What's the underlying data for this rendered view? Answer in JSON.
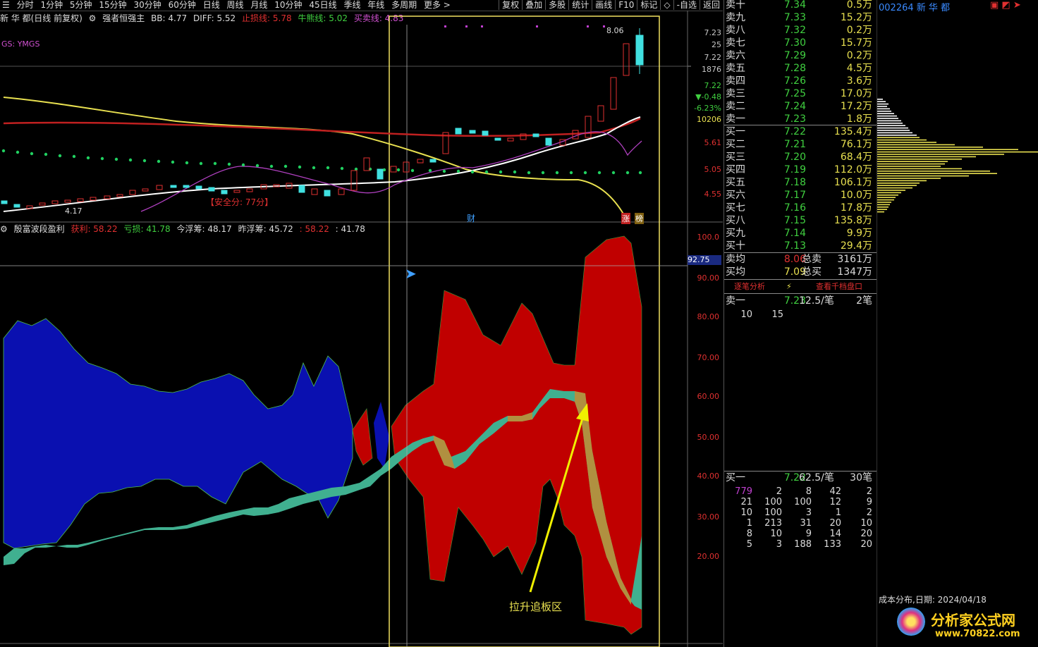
{
  "toolbar": {
    "periods": [
      "分时",
      "1分钟",
      "5分钟",
      "15分钟",
      "30分钟",
      "60分钟",
      "日线",
      "周线",
      "月线",
      "10分钟",
      "45日线",
      "季线",
      "年线",
      "多周期",
      "更多 >"
    ],
    "buttons": [
      "复权",
      "叠加",
      "多股",
      "统计",
      "画线",
      "F10",
      "标记",
      "-自选",
      "返回"
    ]
  },
  "indicator_bar": {
    "stock_label": "新 华 都(日线 前复权)",
    "strategy": "强者恒强主",
    "bb": "BB: 4.77",
    "diff": "DIFF: 5.52",
    "stop_loss": "止损线: 5.78",
    "bull_line": "牛熊线: 5.02",
    "trade_line": "买卖线: 4.83"
  },
  "ygms_label": "GS: YMGS",
  "annotations": {
    "high_price": "8.06",
    "low_price": "4.17",
    "safety_score": "【安全分: 77分】",
    "cai": "财",
    "zhang": "涨",
    "bang": "榜",
    "arrow_text": "拉升追板区"
  },
  "price_axis": {
    "upper_labels": [
      "7.23",
      "25",
      "7.22",
      "1876",
      "7.22",
      "▼-0.48",
      "-6.23%",
      "10206",
      "5.61",
      "5.05",
      "4.55"
    ],
    "lower_labels": [
      "100.0",
      "90.00",
      "80.00",
      "70.00",
      "60.00",
      "50.00",
      "40.00",
      "30.00",
      "20.00"
    ],
    "cursor_value": "92.75"
  },
  "lower_bar": {
    "name": "殷富波段盈利",
    "profit": "获利: 58.22",
    "loss": "亏损: 41.78",
    "today_float": "今浮筹: 48.17",
    "yesterday_float": "昨浮筹: 45.72",
    "v1": ": 58.22",
    "v2": ": 41.78"
  },
  "order_book": {
    "sell": [
      {
        "label": "卖十",
        "price": "7.34",
        "vol": "0.5万"
      },
      {
        "label": "卖九",
        "price": "7.33",
        "vol": "15.2万"
      },
      {
        "label": "卖八",
        "price": "7.32",
        "vol": "0.2万"
      },
      {
        "label": "卖七",
        "price": "7.30",
        "vol": "15.7万"
      },
      {
        "label": "卖六",
        "price": "7.29",
        "vol": "0.2万"
      },
      {
        "label": "卖五",
        "price": "7.28",
        "vol": "4.5万"
      },
      {
        "label": "卖四",
        "price": "7.26",
        "vol": "3.6万"
      },
      {
        "label": "卖三",
        "price": "7.25",
        "vol": "17.0万"
      },
      {
        "label": "卖二",
        "price": "7.24",
        "vol": "17.2万"
      },
      {
        "label": "卖一",
        "price": "7.23",
        "vol": "1.8万"
      }
    ],
    "buy": [
      {
        "label": "买一",
        "price": "7.22",
        "vol": "135.4万"
      },
      {
        "label": "买二",
        "price": "7.21",
        "vol": "76.1万"
      },
      {
        "label": "买三",
        "price": "7.20",
        "vol": "68.4万"
      },
      {
        "label": "买四",
        "price": "7.19",
        "vol": "112.0万"
      },
      {
        "label": "买五",
        "price": "7.18",
        "vol": "106.1万"
      },
      {
        "label": "买六",
        "price": "7.17",
        "vol": "10.0万"
      },
      {
        "label": "买七",
        "price": "7.16",
        "vol": "17.8万"
      },
      {
        "label": "买八",
        "price": "7.15",
        "vol": "135.8万"
      },
      {
        "label": "买九",
        "price": "7.14",
        "vol": "9.9万"
      },
      {
        "label": "买十",
        "price": "7.13",
        "vol": "29.4万"
      }
    ],
    "avg_sell": {
      "label": "卖均",
      "price": "8.06",
      "total_label": "总卖",
      "total": "3161万"
    },
    "avg_buy": {
      "label": "买均",
      "price": "7.09",
      "total_label": "总买",
      "total": "1347万"
    },
    "tabs": [
      "逐笔分析",
      "查看千档盘口"
    ],
    "sell_one_detail": {
      "label": "卖一",
      "price": "7.23",
      "per": "12.5/笔",
      "count": "2笔",
      "q1": "10",
      "q2": "15"
    },
    "buy_one_detail": {
      "label": "买一",
      "price": "7.22",
      "per": "62.5/笔",
      "count": "30笔"
    },
    "queue": [
      [
        "779",
        "2",
        "8",
        "42",
        "2"
      ],
      [
        "21",
        "100",
        "100",
        "12",
        "9"
      ],
      [
        "10",
        "100",
        "3",
        "1",
        "2"
      ],
      [
        "1",
        "213",
        "31",
        "20",
        "10"
      ],
      [
        "8",
        "10",
        "9",
        "14",
        "20"
      ],
      [
        "5",
        "3",
        "188",
        "133",
        "20"
      ]
    ]
  },
  "far_right": {
    "stock_code": "002264 新 华 都",
    "cost_title": "成本分布,日期: 2024/04/18",
    "watermark": "分析家公式网",
    "watermark_url": "www.70822.com"
  },
  "colors": {
    "up": "#e03030",
    "down": "#40e0e0",
    "blue_band": "#0a10b0",
    "red_band": "#c00000",
    "green_band": "#40b090",
    "gold_band": "#b09040"
  }
}
